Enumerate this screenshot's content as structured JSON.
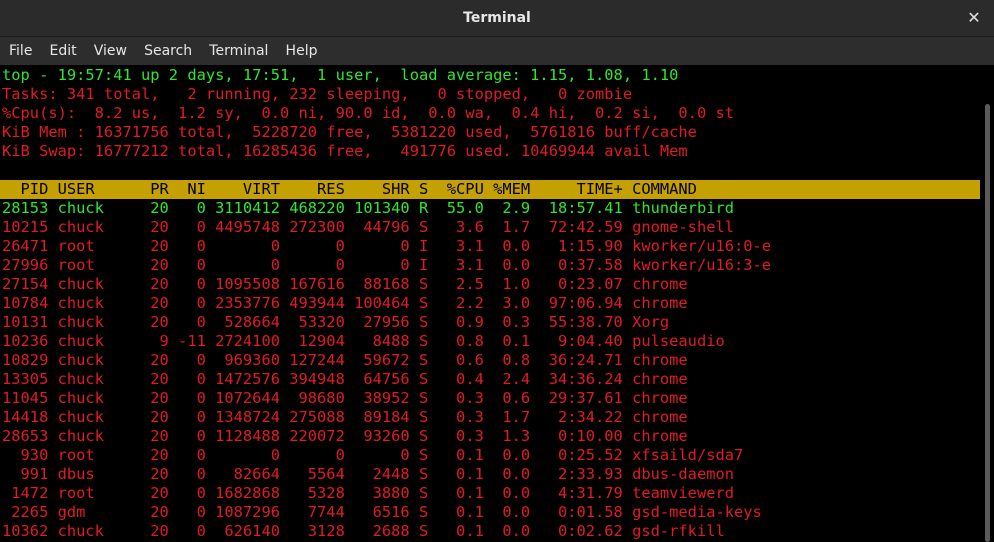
{
  "window": {
    "title": "Terminal",
    "close_glyph": "✕"
  },
  "menu": [
    "File",
    "Edit",
    "View",
    "Search",
    "Terminal",
    "Help"
  ],
  "summary": {
    "uptime_line": "top - 19:57:41 up 2 days, 17:51,  1 user,  load average: 1.15, 1.08, 1.10",
    "tasks_line": "Tasks: 341 total,   2 running, 232 sleeping,   0 stopped,   0 zombie",
    "cpu_line": "%Cpu(s):  8.2 us,  1.2 sy,  0.0 ni, 90.0 id,  0.0 wa,  0.4 hi,  0.2 si,  0.0 st",
    "mem_line": "KiB Mem : 16371756 total,  5228720 free,  5381220 used,  5761816 buff/cache",
    "swap_line": "KiB Swap: 16777212 total, 16285436 free,   491776 used. 10469944 avail Mem"
  },
  "table": {
    "header": "  PID USER      PR  NI    VIRT    RES    SHR S  %CPU %MEM     TIME+ COMMAND",
    "rows": [
      "28153 chuck     20   0 3110412 468220 101340 R  55.0  2.9  18:57.41 thunderbird",
      "10215 chuck     20   0 4495748 272300  44796 S   3.6  1.7  72:42.59 gnome-shell",
      "26471 root      20   0       0      0      0 I   3.1  0.0   1:15.90 kworker/u16:0-e",
      "27996 root      20   0       0      0      0 I   3.1  0.0   0:37.58 kworker/u16:3-e",
      "27154 chuck     20   0 1095508 167616  88168 S   2.5  1.0   0:23.07 chrome",
      "10784 chuck     20   0 2353776 493944 100464 S   2.2  3.0  97:06.94 chrome",
      "10131 chuck     20   0  528664  53320  27956 S   0.9  0.3  55:38.70 Xorg",
      "10236 chuck      9 -11 2724100  12904   8488 S   0.8  0.1   9:04.40 pulseaudio",
      "10829 chuck     20   0  969360 127244  59672 S   0.6  0.8  36:24.71 chrome",
      "13305 chuck     20   0 1472576 394948  64756 S   0.4  2.4  34:36.24 chrome",
      "11045 chuck     20   0 1072644  98680  38952 S   0.3  0.6  29:37.61 chrome",
      "14418 chuck     20   0 1348724 275088  89184 S   0.3  1.7   2:34.22 chrome",
      "28653 chuck     20   0 1128488 220072  93260 S   0.3  1.3   0:10.00 chrome",
      "  930 root      20   0       0      0      0 S   0.1  0.0   0:25.52 xfsaild/sda7",
      "  991 dbus      20   0   82664   5564   2448 S   0.1  0.0   2:33.93 dbus-daemon",
      " 1472 root      20   0 1682868   5328   3880 S   0.1  0.0   4:31.79 teamviewerd",
      " 2265 gdm       20   0 1087296   7744   6516 S   0.1  0.0   0:01.58 gsd-media-keys",
      "10362 chuck     20   0  626140   3128   2688 S   0.1  0.0   0:02.62 gsd-rfkill"
    ]
  },
  "colors": {
    "green": "#2ee62e",
    "red": "#e01b24",
    "header_bg": "#c4a000"
  }
}
